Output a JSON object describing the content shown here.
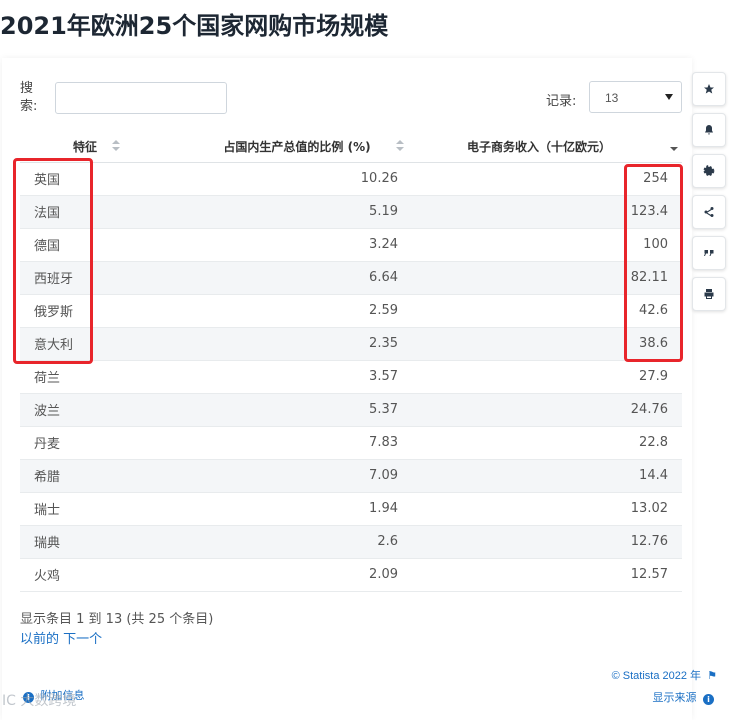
{
  "page": {
    "title": "2021年欧洲25个国家网购市场规模"
  },
  "search": {
    "label": "搜索:",
    "value": ""
  },
  "records": {
    "label": "记录:",
    "selected": "13"
  },
  "table": {
    "headers": [
      "特征",
      "占国内生产总值的比例 (%)",
      "电子商务收入（十亿欧元）"
    ],
    "rows": [
      [
        "英国",
        "10.26",
        "254"
      ],
      [
        "法国",
        "5.19",
        "123.4"
      ],
      [
        "德国",
        "3.24",
        "100"
      ],
      [
        "西班牙",
        "6.64",
        "82.11"
      ],
      [
        "俄罗斯",
        "2.59",
        "42.6"
      ],
      [
        "意大利",
        "2.35",
        "38.6"
      ],
      [
        "荷兰",
        "3.57",
        "27.9"
      ],
      [
        "波兰",
        "5.37",
        "24.76"
      ],
      [
        "丹麦",
        "7.83",
        "22.8"
      ],
      [
        "希腊",
        "7.09",
        "14.4"
      ],
      [
        "瑞士",
        "1.94",
        "13.02"
      ],
      [
        "瑞典",
        "2.6",
        "12.76"
      ],
      [
        "火鸡",
        "2.09",
        "12.57"
      ]
    ]
  },
  "footer": {
    "entries": "显示条目 1 到 13 (共 25 个条目)",
    "prev": "以前的",
    "next": "下一个",
    "copyright": "© Statista 2022 年",
    "show_source": "显示来源",
    "extra_info": "附加信息"
  },
  "watermark": "IC 大数跨境",
  "sidebar": {
    "icons": [
      "star-icon",
      "bell-icon",
      "gear-icon",
      "share-icon",
      "quote-icon",
      "print-icon"
    ]
  },
  "colors": {
    "accent": "#1a6fc4",
    "highlight": "#e8252b",
    "row_alt": "#f4f6f8"
  }
}
